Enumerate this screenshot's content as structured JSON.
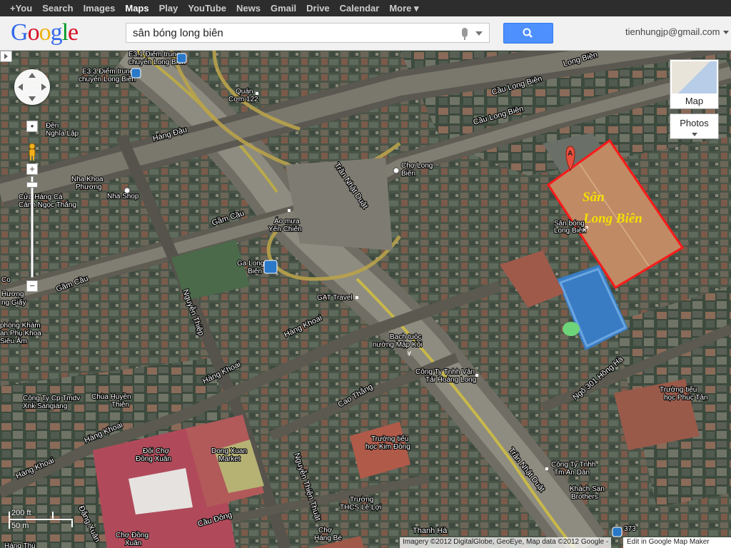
{
  "topbar": {
    "items": [
      "+You",
      "Search",
      "Images",
      "Maps",
      "Play",
      "YouTube",
      "News",
      "Gmail",
      "Drive",
      "Calendar",
      "More ▾"
    ],
    "active": "Maps"
  },
  "header": {
    "logo_letters": [
      "G",
      "o",
      "o",
      "g",
      "l",
      "e"
    ],
    "logo_colors": [
      "#3369e8",
      "#d50f25",
      "#eeb211",
      "#3369e8",
      "#009925",
      "#d50f25"
    ],
    "search_value": "sân bóng long biên",
    "user_email": "tienhungjp@gmail.com"
  },
  "controls": {
    "map_type_label": "Map",
    "photos_label": "Photos",
    "zoom_in": "+",
    "zoom_out": "−"
  },
  "marker": {
    "label": "A"
  },
  "overlay": {
    "line1": "Sân",
    "line2": "Long Biên",
    "color": "#ff1a1a",
    "text_color": "#f2e000"
  },
  "scale": {
    "top": "200 ft",
    "bottom": "50 m"
  },
  "attribution": "Imagery ©2012 DigitalGlobe, GeoEye, Map data ©2012 Google -",
  "map_maker_link": "Edit in Google Map Maker",
  "streets": [
    "Hàng Đậu",
    "Gầm Cầu",
    "Gầm Cầu",
    "Trần Nhật Duật",
    "Trần Nhật Duật",
    "Nguyễn Thiệp",
    "Hàng Khoai",
    "Hàng Khoai",
    "Hàng Khoai",
    "Hàng Khoai",
    "Cao Thắng",
    "Nguyễn Thiện Thuật",
    "Cầu Đông",
    "Thanh Hà",
    "Đặng Xuân",
    "Cầu Long Biên",
    "Cầu Long Biên",
    "Long Biên",
    "Ngõ 301 Hồng Hà"
  ],
  "places": [
    "E3.1 Điểm trung",
    "chuyển Long Biên",
    "E3.3 Điểm trung",
    "chuyển Long Biên",
    "Quán",
    "Cơm 122",
    "Đền",
    "Nghĩa Lập",
    "Nha Khoa",
    "Phương",
    "Nha Shop",
    "Cửa Hàng Cá",
    "Cảnh Ngọc Thắng",
    "Áo mưa",
    "Yến Chiến",
    "Ga Long",
    "Biên",
    "Chợ Long",
    "Biên",
    "Sân bóng",
    "Long Biên",
    "GAT Travel",
    "Bạch tuộc",
    "nướng Mập Kôi",
    "Công Ty Tnhh Vận",
    "Tải Hoàng Long",
    "Công Ty Cp Tmdv",
    "Xnk Sangiang",
    "Chùa Huyền",
    "Thiên",
    "Đội Chợ",
    "Đồng Xuân",
    "Dong Xuan",
    "Market",
    "Trường tiểu",
    "học Kim Đồng",
    "Trường",
    "THCS Lê Lợi",
    "Chợ",
    "Hàng Bè",
    "Chợ Đồng",
    "Xuân",
    "Công Ty Tnhh",
    "Tm An Dân",
    "Khách Sạn",
    "Brothers",
    "Trường tiểu",
    "học Phúc Tân",
    "Co",
    "Hương",
    "ng Giấy",
    "phòng Khám",
    "an Phụ Khoa",
    "Siêu Âm",
    "Hàng Thù",
    "373"
  ]
}
